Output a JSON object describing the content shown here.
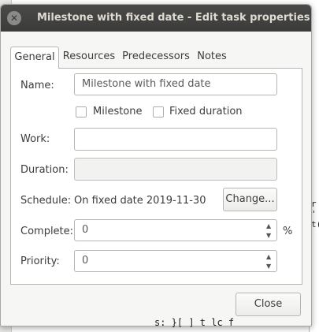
{
  "background": {
    "bottom_text": "s: }[ ]   t   lc     f ",
    "right_glyphs": [
      "r",
      "'",
      "t("
    ]
  },
  "dialog": {
    "title": "Milestone with fixed date - Edit task properties",
    "close_icon": "close-icon"
  },
  "tabs": [
    {
      "label": "General",
      "active": true
    },
    {
      "label": "Resources",
      "active": false
    },
    {
      "label": "Predecessors",
      "active": false
    },
    {
      "label": "Notes",
      "active": false
    }
  ],
  "general": {
    "name_label": "Name:",
    "name_value": "Milestone with fixed date",
    "milestone_label": "Milestone",
    "milestone_checked": false,
    "fixed_duration_label": "Fixed duration",
    "fixed_duration_checked": false,
    "work_label": "Work:",
    "work_value": "",
    "duration_label": "Duration:",
    "duration_value": "",
    "schedule_label": "Schedule:",
    "schedule_value": "On fixed date 2019-11-30",
    "change_button": "Change...",
    "complete_label": "Complete:",
    "complete_value": "0",
    "complete_unit": "%",
    "priority_label": "Priority:",
    "priority_value": "0"
  },
  "footer": {
    "close_button": "Close"
  }
}
